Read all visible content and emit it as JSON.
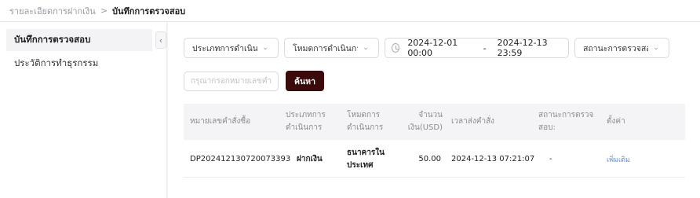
{
  "breadcrumb": {
    "parent": "รายละเอียดการฝากเงิน",
    "separator": ">",
    "current": "บันทึกการตรวจสอบ"
  },
  "sidebar": {
    "items": [
      {
        "label": "บันทึกการตรวจสอบ",
        "active": true
      },
      {
        "label": "ประวัติการทำธุรกรรม",
        "active": false
      }
    ],
    "collapse_icon": "‹"
  },
  "filters": {
    "operation_type": "ประเภทการดำเนินการทั้งหมด",
    "operation_mode": "โหมดการดำเนินการทั้งหมด",
    "date_start": "2024-12-01 00:00",
    "date_separator": "-",
    "date_end": "2024-12-13 23:59",
    "review_status": "สถานะการตรวจสอบทั้งหมด",
    "order_placeholder": "กรุณากรอกหมายเลขคำสั่งซื้อ",
    "search_label": "ค้นหา"
  },
  "table": {
    "columns": [
      "หมายเลขคำสั่งซื้อ",
      "ประเภทการดำเนินการ",
      "โหมดการดำเนินการ",
      "จำนวนเงิน(USD)",
      "เวลาส่งคำสั่ง",
      "สถานะการตรวจสอบ:",
      "ตั้งค่า"
    ],
    "rows": [
      {
        "order_no": "DP202412130720073393",
        "operation_type": "ฝากเงิน",
        "operation_mode": "ธนาคารในประเทศ",
        "amount": "50.00",
        "submit_time": "2024-12-13 07:21:07",
        "status": "-",
        "action": "เพิ่มเติม"
      }
    ]
  },
  "colors": {
    "search_button_bg": "#3b0a0a",
    "link": "#5b8fd9"
  }
}
